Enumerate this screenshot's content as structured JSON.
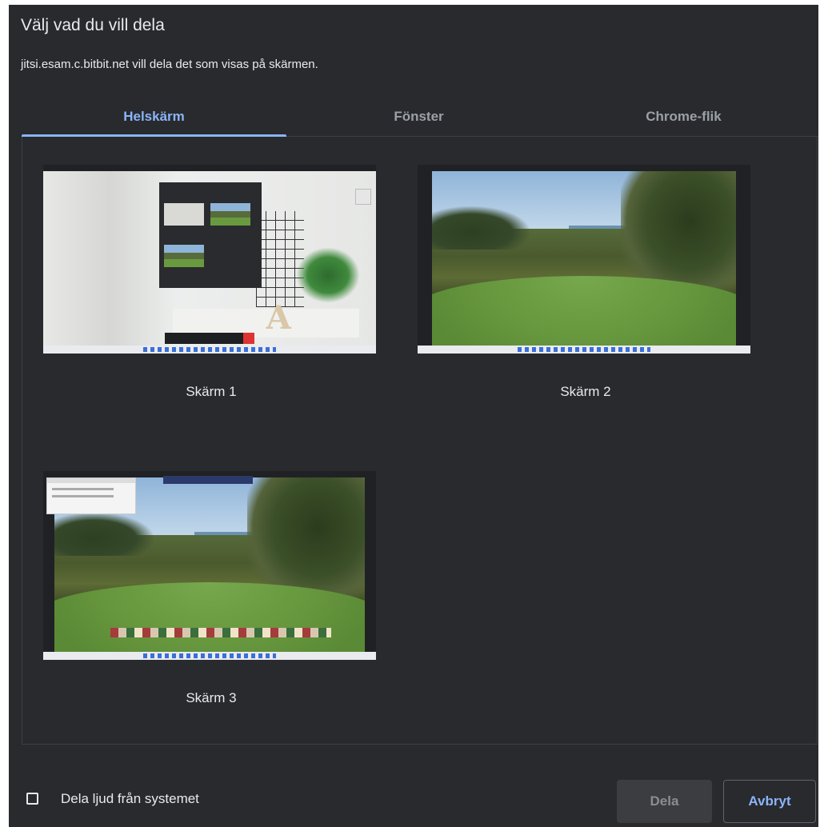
{
  "dialog": {
    "title": "Välj vad du vill dela",
    "subtitle": "jitsi.esam.c.bitbit.net vill dela det som visas på skärmen."
  },
  "tabs": [
    {
      "label": "Helskärm",
      "active": true
    },
    {
      "label": "Fönster",
      "active": false
    },
    {
      "label": "Chrome-flik",
      "active": false
    }
  ],
  "sources": [
    {
      "label": "Skärm 1"
    },
    {
      "label": "Skärm 2"
    },
    {
      "label": "Skärm 3"
    }
  ],
  "footer": {
    "audio_checkbox_label": "Dela ljud från systemet",
    "audio_checked": false,
    "share_label": "Dela",
    "cancel_label": "Avbryt"
  },
  "colors": {
    "background": "#292a2d",
    "accent": "#8ab4f8",
    "text": "#e8eaed",
    "muted": "#9aa0a6"
  }
}
